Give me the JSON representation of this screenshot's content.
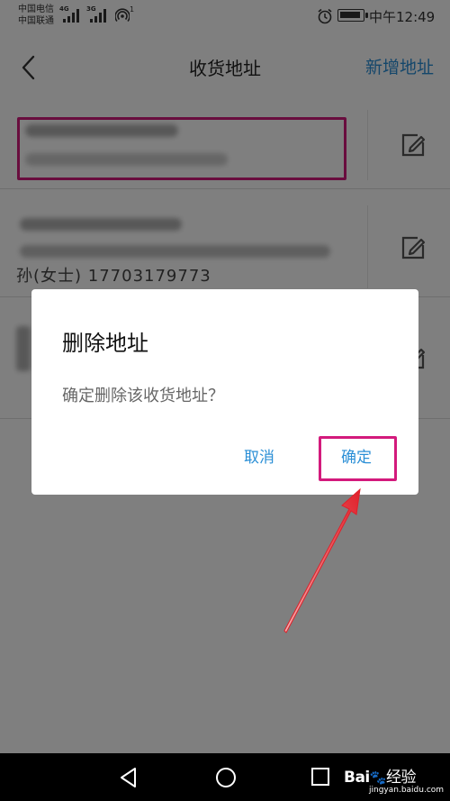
{
  "status_bar": {
    "carrier1": "中国电信",
    "carrier2": "中国联通",
    "net1": "4G",
    "net2": "3G",
    "wifi_badge": "1",
    "time": "中午12:49"
  },
  "header": {
    "title": "收货地址",
    "add_label": "新增地址"
  },
  "address_list": {
    "items": [
      {
        "name": ""
      },
      {
        "name": "孙(女士)  17703179773"
      },
      {
        "name": ""
      }
    ]
  },
  "dialog": {
    "title": "删除地址",
    "message": "确定删除该收货地址？",
    "cancel_label": "取消",
    "confirm_label": "确定"
  },
  "watermark": {
    "logo_text": "Bai",
    "logo_suffix": "经验",
    "site": "jingyan.baidu.com"
  },
  "colors": {
    "accent": "#2b8fd6",
    "highlight": "#d31a7c",
    "arrow": "#e0202a"
  }
}
